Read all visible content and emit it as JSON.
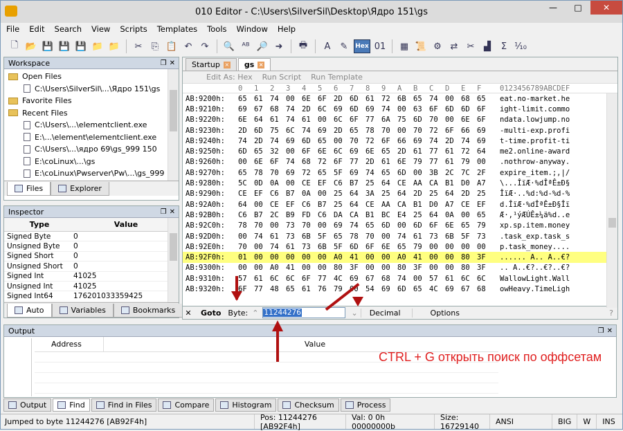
{
  "window": {
    "title": "010 Editor - C:\\Users\\SilverSil\\Desktop\\Ядро 151\\gs",
    "min": "—",
    "max": "□",
    "close": "✕"
  },
  "menu": [
    "File",
    "Edit",
    "Search",
    "View",
    "Scripts",
    "Templates",
    "Tools",
    "Window",
    "Help"
  ],
  "toolbar": {
    "hex_label": "Hex"
  },
  "workspace": {
    "title": "Workspace",
    "items": [
      {
        "label": "Open Files",
        "type": "folder",
        "indent": 0
      },
      {
        "label": "C:\\Users\\SilverSil\\...\\Ядро 151\\gs",
        "type": "file",
        "indent": 1
      },
      {
        "label": "Favorite Files",
        "type": "folder",
        "indent": 0
      },
      {
        "label": "Recent Files",
        "type": "folder",
        "indent": 0
      },
      {
        "label": "C:\\Users\\...\\elementclient.exe",
        "type": "file",
        "indent": 1
      },
      {
        "label": "E:\\...\\element\\elementclient.exe",
        "type": "file",
        "indent": 1
      },
      {
        "label": "C:\\Users\\...\\ядро 69\\gs_999 150",
        "type": "file",
        "indent": 1
      },
      {
        "label": "E:\\coLinux\\...\\gs",
        "type": "file",
        "indent": 1
      },
      {
        "label": "E:\\coLinux\\Pwserver\\Pw\\...\\gs_999",
        "type": "file",
        "indent": 1
      }
    ],
    "tabs": [
      "Files",
      "Explorer"
    ]
  },
  "inspector": {
    "title": "Inspector",
    "col_type": "Type",
    "col_value": "Value",
    "rows": [
      [
        "Signed Byte",
        "0"
      ],
      [
        "Unsigned Byte",
        "0"
      ],
      [
        "Signed Short",
        "0"
      ],
      [
        "Unsigned Short",
        "0"
      ],
      [
        "Signed Int",
        "41025"
      ],
      [
        "Unsigned Int",
        "41025"
      ],
      [
        "Signed Int64",
        "176201033359425"
      ]
    ],
    "tabs": [
      "Auto",
      "Variables",
      "Bookmarks"
    ]
  },
  "editor": {
    "tabs": [
      "Startup",
      "gs"
    ],
    "options": [
      "Edit As: Hex",
      "Run Script",
      "Run Template"
    ],
    "col_header": [
      "0",
      "1",
      "2",
      "3",
      "4",
      "5",
      "6",
      "7",
      "8",
      "9",
      "A",
      "B",
      "C",
      "D",
      "E",
      "F"
    ],
    "ascii_header": "0123456789ABCDEF",
    "rows": [
      {
        "addr": "AB:9200h:",
        "bytes": "65 61 74 00 6E 6F 2D 6D 61 72 6B 65 74 00 68 65",
        "ascii": "eat.no-market.he"
      },
      {
        "addr": "AB:9210h:",
        "bytes": "69 67 68 74 2D 6C 69 6D 69 74 00 63 6F 6D 6D 6F",
        "ascii": "ight-limit.commo"
      },
      {
        "addr": "AB:9220h:",
        "bytes": "6E 64 61 74 61 00 6C 6F 77 6A 75 6D 70 00 6E 6F",
        "ascii": "ndata.lowjump.no"
      },
      {
        "addr": "AB:9230h:",
        "bytes": "2D 6D 75 6C 74 69 2D 65 78 70 00 70 72 6F 66 69",
        "ascii": "-multi-exp.profi"
      },
      {
        "addr": "AB:9240h:",
        "bytes": "74 2D 74 69 6D 65 00 70 72 6F 66 69 74 2D 74 69",
        "ascii": "t-time.profit-ti"
      },
      {
        "addr": "AB:9250h:",
        "bytes": "6D 65 32 00 6F 6E 6C 69 6E 65 2D 61 77 61 72 64",
        "ascii": "me2.online-award"
      },
      {
        "addr": "AB:9260h:",
        "bytes": "00 6E 6F 74 68 72 6F 77 2D 61 6E 79 77 61 79 00",
        "ascii": ".nothrow-anyway."
      },
      {
        "addr": "AB:9270h:",
        "bytes": "65 78 70 69 72 65 5F 69 74 65 6D 00 3B 2C 7C 2F",
        "ascii": "expire_item.;,|/"
      },
      {
        "addr": "AB:9280h:",
        "bytes": "5C 0D 0A 00 CE EF C6 B7 25 64 CE AA CA B1 D0 A7",
        "ascii": "\\...ÎïÆ·%dÎªÊ±Ð§"
      },
      {
        "addr": "AB:9290h:",
        "bytes": "CE EF C6 B7 0A 00 25 64 3A 25 64 2D 25 64 2D 25",
        "ascii": "ÎïÆ·..%d:%d-%d-%"
      },
      {
        "addr": "AB:92A0h:",
        "bytes": "64 00 CE EF C6 B7 25 64 CE AA CA B1 D0 A7 CE EF",
        "ascii": "d.ÎïÆ·%dÎªÊ±Ð§Îï"
      },
      {
        "addr": "AB:92B0h:",
        "bytes": "C6 B7 2C B9 FD C6 DA CA B1 BC E4 25 64 0A 00 65",
        "ascii": "Æ·,¹ýÆÚÊ±¼ä%d..e"
      },
      {
        "addr": "AB:92C0h:",
        "bytes": "78 70 00 73 70 00 69 74 65 6D 00 6D 6F 6E 65 79",
        "ascii": "xp.sp.item.money"
      },
      {
        "addr": "AB:92D0h:",
        "bytes": "00 74 61 73 6B 5F 65 78 70 00 74 61 73 6B 5F 73",
        "ascii": ".task_exp.task_s"
      },
      {
        "addr": "AB:92E0h:",
        "bytes": "70 00 74 61 73 6B 5F 6D 6F 6E 65 79 00 00 00 00",
        "ascii": "p.task_money...."
      },
      {
        "addr": "AB:92F0h:",
        "bytes": "01 00 00 00 00 00 A0 41 00 00 A0 41 00 00 80 3F",
        "ascii": "...... A.. A..€?",
        "sel": true
      },
      {
        "addr": "AB:9300h:",
        "bytes": "00 00 A0 41 00 00 80 3F 00 00 80 3F 00 00 80 3F",
        "ascii": ".. A..€?..€?..€?"
      },
      {
        "addr": "AB:9310h:",
        "bytes": "57 61 6C 6C 6F 77 4C 69 67 68 74 00 57 61 6C 6C",
        "ascii": "WallowLight.Wall"
      },
      {
        "addr": "AB:9320h:",
        "bytes": "6F 77 48 65 61 76 79 00 54 69 6D 65 4C 69 67 68",
        "ascii": "owHeavy.TimeLigh"
      }
    ]
  },
  "goto": {
    "close": "✕",
    "label": "Goto",
    "byte_label": "Byte:",
    "value": "11244276",
    "mode": "Decimal",
    "options": "Options",
    "help": "?"
  },
  "output": {
    "title": "Output",
    "col_address": "Address",
    "col_value": "Value"
  },
  "bottom_tabs": [
    "Output",
    "Find",
    "Find in Files",
    "Compare",
    "Histogram",
    "Checksum",
    "Process"
  ],
  "status": {
    "message": "Jumped to byte 11244276 [AB92F4h]",
    "pos": "Pos: 11244276 [AB92F4h]",
    "val": "Val: 0 0h 00000000b",
    "size": "Size: 16729140",
    "encoding": "ANSI",
    "endian": "BIG",
    "mode1": "W",
    "mode2": "INS"
  },
  "annotation": "CTRL + G открыть поиск по оффсетам",
  "colors": {
    "selection": "#ffff80",
    "annotation": "#e02020",
    "arrow": "#b01010",
    "accent": "#3370c8"
  }
}
